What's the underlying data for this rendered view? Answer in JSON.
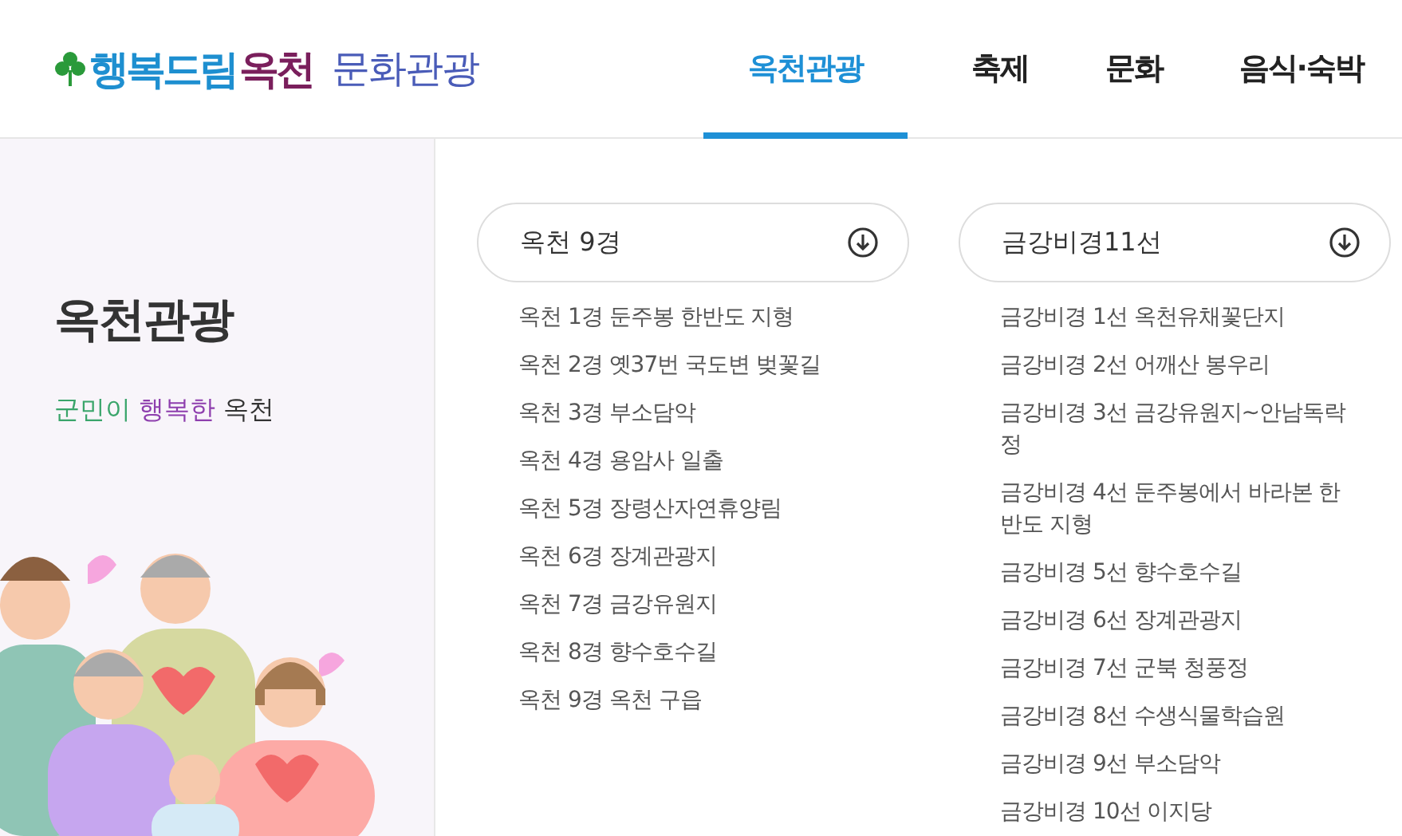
{
  "logo": {
    "parts": [
      {
        "text": "행복드림",
        "color": "#1e8fd0"
      },
      {
        "text": "옥천",
        "color": "#7a1f5c"
      },
      {
        "text": "문화관광",
        "color": "#4a5cb8"
      }
    ]
  },
  "nav": [
    {
      "label": "옥천관광",
      "selected": true
    },
    {
      "label": "축제",
      "selected": false
    },
    {
      "label": "문화",
      "selected": false
    },
    {
      "label": "음식·숙박",
      "selected": false
    }
  ],
  "sidebar": {
    "title": "옥천관광",
    "subtitle": [
      {
        "text": "군민이",
        "color": "#3aa56b"
      },
      {
        "text": "행복한",
        "color": "#8e3fae"
      },
      {
        "text": "옥천",
        "color": "#333333"
      }
    ]
  },
  "sections": [
    {
      "title": "옥천 9경",
      "items": [
        "옥천 1경 둔주봉 한반도 지형",
        "옥천 2경 옛37번 국도변 벚꽃길",
        "옥천 3경 부소담악",
        "옥천 4경 용암사 일출",
        "옥천 5경 장령산자연휴양림",
        "옥천 6경 장계관광지",
        "옥천 7경 금강유원지",
        "옥천 8경 향수호수길",
        "옥천 9경 옥천 구읍"
      ]
    },
    {
      "title": "금강비경11선",
      "items": [
        "금강비경 1선 옥천유채꽃단지",
        "금강비경 2선 어깨산 봉우리",
        "금강비경 3선 금강유원지~안남독락정",
        "금강비경 4선 둔주봉에서 바라본 한반도 지형",
        "금강비경 5선 향수호수길",
        "금강비경 6선 장계관광지",
        "금강비경 7선 군북 청풍정",
        "금강비경 8선 수생식물학습원",
        "금강비경 9선 부소담악",
        "금강비경 10선 이지당"
      ]
    }
  ]
}
